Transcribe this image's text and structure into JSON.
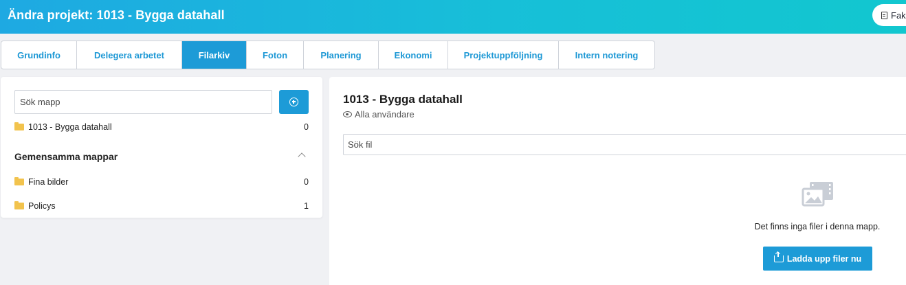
{
  "header": {
    "title": "Ändra projekt: 1013 - Bygga datahall",
    "button_label": "Fak"
  },
  "tabs": [
    {
      "label": "Grundinfo",
      "active": false
    },
    {
      "label": "Delegera arbetet",
      "active": false
    },
    {
      "label": "Filarkiv",
      "active": true
    },
    {
      "label": "Foton",
      "active": false
    },
    {
      "label": "Planering",
      "active": false
    },
    {
      "label": "Ekonomi",
      "active": false
    },
    {
      "label": "Projektuppföljning",
      "active": false
    },
    {
      "label": "Intern notering",
      "active": false
    }
  ],
  "left": {
    "search_placeholder": "Sök mapp",
    "project_folder": {
      "name": "1013 - Bygga datahall",
      "count": "0"
    },
    "shared_title": "Gemensamma mappar",
    "shared_folders": [
      {
        "name": "Fina bilder",
        "count": "0"
      },
      {
        "name": "Policys",
        "count": "1"
      }
    ]
  },
  "right": {
    "title": "1013 - Bygga datahall",
    "visibility": "Alla användare",
    "search_placeholder": "Sök fil",
    "empty_message": "Det finns inga filer i denna mapp.",
    "upload_button": "Ladda upp filer nu"
  },
  "colors": {
    "accent": "#1d9bd7",
    "header_gradient_start": "#1ea9e2",
    "header_gradient_end": "#12c7cf",
    "folder": "#f2c34d"
  },
  "icons": [
    "document-icon",
    "plus-circle-icon",
    "folder-icon",
    "chevron-up-icon",
    "eye-icon",
    "image-gallery-icon",
    "upload-icon"
  ]
}
